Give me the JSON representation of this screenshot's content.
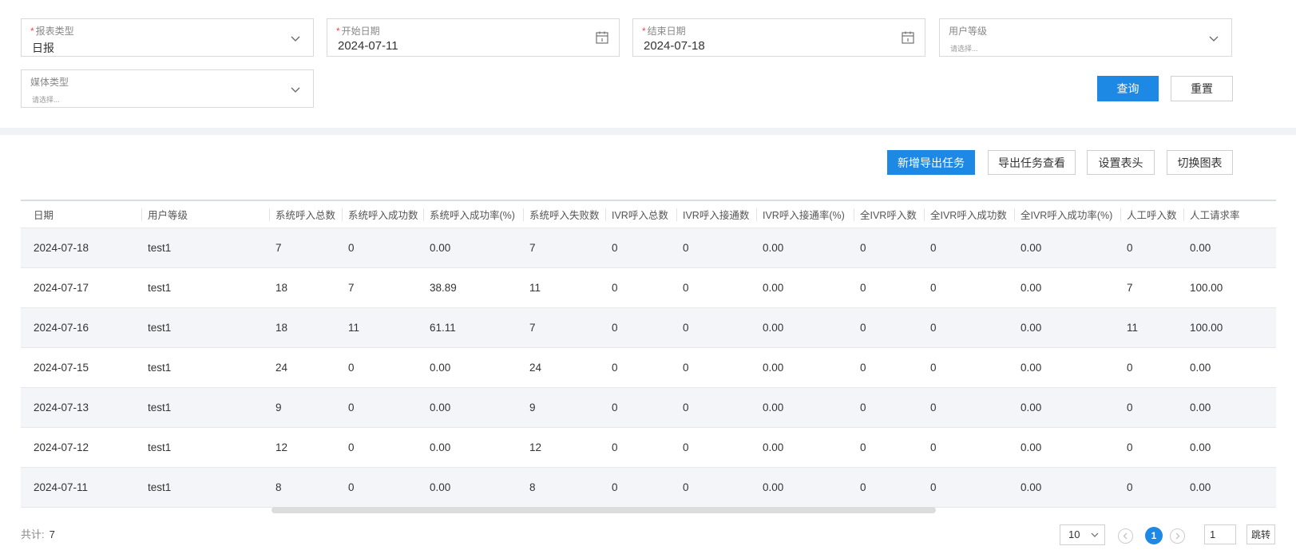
{
  "filters": {
    "report_type": {
      "label": "报表类型",
      "required": "*",
      "value": "日报"
    },
    "start_date": {
      "label": "开始日期",
      "required": "*",
      "value": "2024-07-11"
    },
    "end_date": {
      "label": "结束日期",
      "required": "*",
      "value": "2024-07-18"
    },
    "user_level": {
      "label": "用户等级",
      "placeholder": "请选择..."
    },
    "media_type": {
      "label": "媒体类型",
      "placeholder": "请选择..."
    },
    "query_label": "查询",
    "reset_label": "重置"
  },
  "toolbar": {
    "new_export": "新增导出任务",
    "view_export": "导出任务查看",
    "set_header": "设置表头",
    "switch_chart": "切换图表"
  },
  "table": {
    "headers": [
      "日期",
      "用户等级",
      "系统呼入总数",
      "系统呼入成功数",
      "系统呼入成功率(%)",
      "系统呼入失败数",
      "IVR呼入总数",
      "IVR呼入接通数",
      "IVR呼入接通率(%)",
      "全IVR呼入数",
      "全IVR呼入成功数",
      "全IVR呼入成功率(%)",
      "人工呼入数",
      "人工请求率"
    ],
    "rows": [
      [
        "2024-07-18",
        "test1",
        "7",
        "0",
        "0.00",
        "7",
        "0",
        "0",
        "0.00",
        "0",
        "0",
        "0.00",
        "0",
        "0.00"
      ],
      [
        "2024-07-17",
        "test1",
        "18",
        "7",
        "38.89",
        "11",
        "0",
        "0",
        "0.00",
        "0",
        "0",
        "0.00",
        "7",
        "100.00"
      ],
      [
        "2024-07-16",
        "test1",
        "18",
        "11",
        "61.11",
        "7",
        "0",
        "0",
        "0.00",
        "0",
        "0",
        "0.00",
        "11",
        "100.00"
      ],
      [
        "2024-07-15",
        "test1",
        "24",
        "0",
        "0.00",
        "24",
        "0",
        "0",
        "0.00",
        "0",
        "0",
        "0.00",
        "0",
        "0.00"
      ],
      [
        "2024-07-13",
        "test1",
        "9",
        "0",
        "0.00",
        "9",
        "0",
        "0",
        "0.00",
        "0",
        "0",
        "0.00",
        "0",
        "0.00"
      ],
      [
        "2024-07-12",
        "test1",
        "12",
        "0",
        "0.00",
        "12",
        "0",
        "0",
        "0.00",
        "0",
        "0",
        "0.00",
        "0",
        "0.00"
      ],
      [
        "2024-07-11",
        "test1",
        "8",
        "0",
        "0.00",
        "8",
        "0",
        "0",
        "0.00",
        "0",
        "0",
        "0.00",
        "0",
        "0.00"
      ]
    ]
  },
  "footer": {
    "total_label": "共计:",
    "total_value": "7",
    "page_size": "10",
    "current_page": "1",
    "page_input": "1",
    "jump_label": "跳转"
  },
  "colors": {
    "accent": "#1e88e5",
    "required": "#e34d4d",
    "stripe": "#f4f5f8"
  }
}
